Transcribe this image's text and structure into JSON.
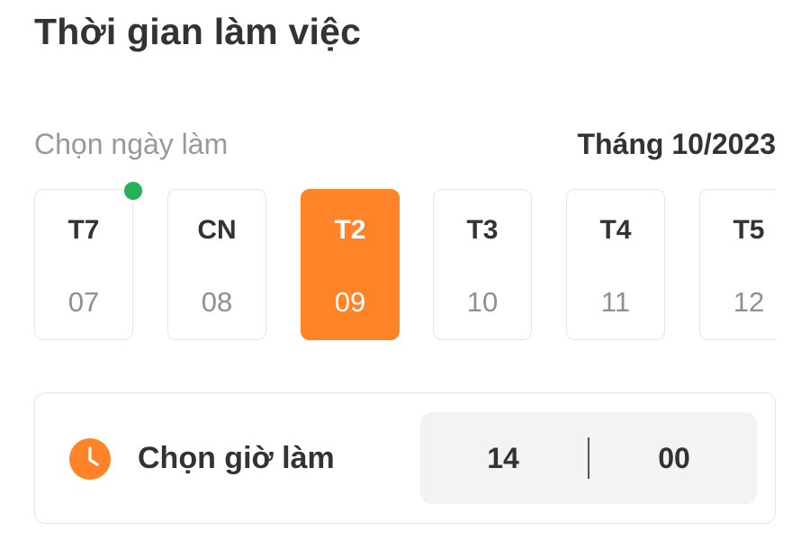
{
  "title": "Thời gian làm việc",
  "day_picker": {
    "label": "Chọn ngày làm",
    "month": "Tháng 10/2023",
    "days": [
      {
        "weekday": "T7",
        "day": "07",
        "selected": false,
        "has_dot": true
      },
      {
        "weekday": "CN",
        "day": "08",
        "selected": false,
        "has_dot": false
      },
      {
        "weekday": "T2",
        "day": "09",
        "selected": true,
        "has_dot": false
      },
      {
        "weekday": "T3",
        "day": "10",
        "selected": false,
        "has_dot": false
      },
      {
        "weekday": "T4",
        "day": "11",
        "selected": false,
        "has_dot": false
      },
      {
        "weekday": "T5",
        "day": "12",
        "selected": false,
        "has_dot": false
      }
    ]
  },
  "time_picker": {
    "icon": "clock-icon",
    "label": "Chọn giờ làm",
    "hour": "14",
    "minute": "00"
  },
  "colors": {
    "accent": "#ff8428",
    "indicator": "#27b05a",
    "border": "#e6e6e6",
    "picker_bg": "#f3f3f3"
  }
}
